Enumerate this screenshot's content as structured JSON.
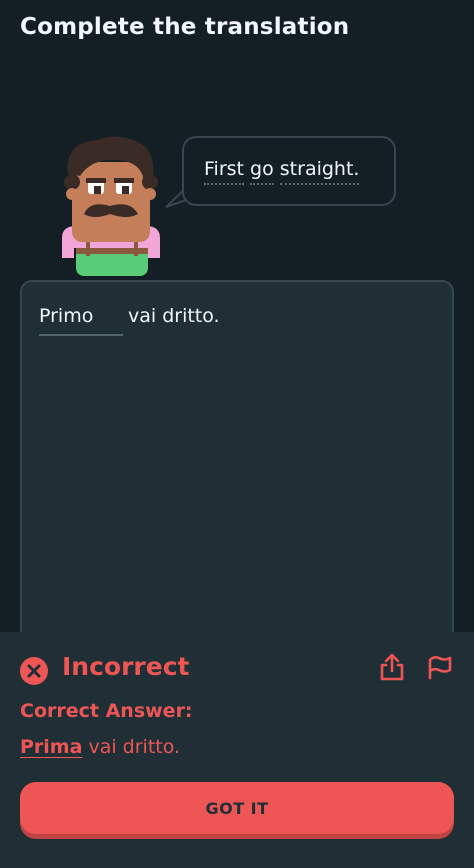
{
  "header": {
    "title": "Complete the translation"
  },
  "prompt": {
    "words": [
      "First",
      "go",
      "straight."
    ]
  },
  "exercise": {
    "answer_value": "Primo",
    "sentence_rest": "vai dritto."
  },
  "feedback": {
    "status": "Incorrect",
    "correct_label": "Correct Answer:",
    "correct_fix": "Prima",
    "correct_rest": " vai dritto.",
    "continue_label": "GOT IT",
    "status_color": "#ee5555",
    "icons": [
      "close-circle-icon",
      "share-icon",
      "flag-icon"
    ]
  },
  "colors": {
    "background": "#141f25",
    "card": "#202f36",
    "border": "#37464f",
    "error": "#ee5555"
  }
}
